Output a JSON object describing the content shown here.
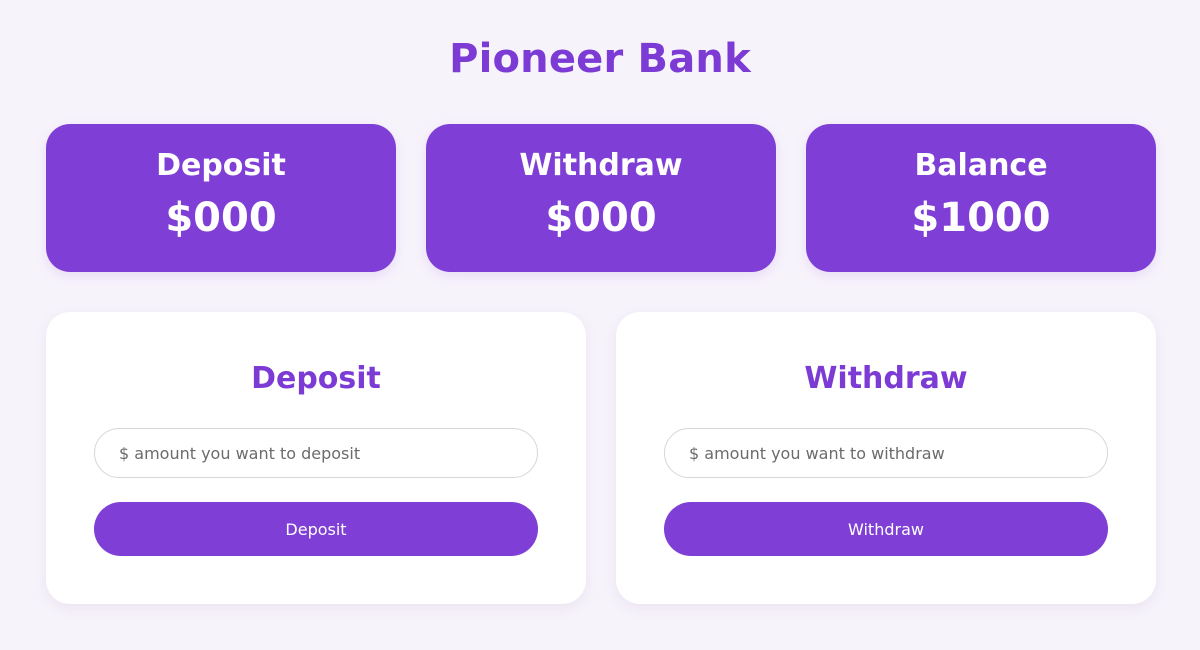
{
  "header": {
    "title": "Pioneer Bank"
  },
  "stats": [
    {
      "label": "Deposit",
      "value": "$000"
    },
    {
      "label": "Withdraw",
      "value": "$000"
    },
    {
      "label": "Balance",
      "value": "$1000"
    }
  ],
  "deposit_panel": {
    "title": "Deposit",
    "input_value": "",
    "input_placeholder": "$ amount you want to deposit",
    "button_label": "Deposit"
  },
  "withdraw_panel": {
    "title": "Withdraw",
    "input_value": "",
    "input_placeholder": "$ amount you want to withdraw",
    "button_label": "Withdraw"
  },
  "colors": {
    "accent": "#7f3fd6",
    "title": "#7c3bd4",
    "background": "#f7f3fb",
    "card_text": "#ffffff"
  }
}
